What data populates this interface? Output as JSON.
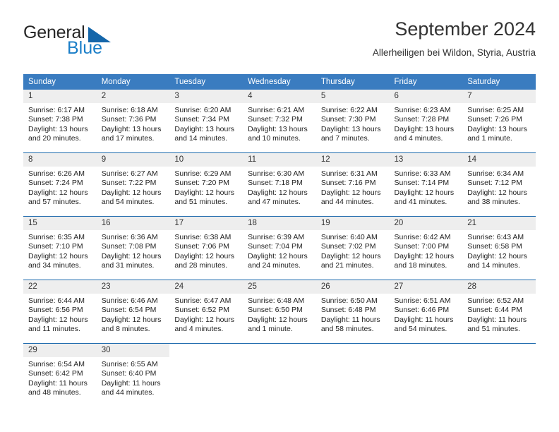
{
  "brand": {
    "name_part1": "General",
    "name_part2": "Blue",
    "accent_color": "#1a7ec8",
    "triangle_color": "#1466aa"
  },
  "header": {
    "title": "September 2024",
    "subtitle": "Allerheiligen bei Wildon, Styria, Austria"
  },
  "theme": {
    "header_bg": "#3a7cc0",
    "row_border": "#1d6aad",
    "daynum_bg": "#eeeeee"
  },
  "weekday_headers": [
    "Sunday",
    "Monday",
    "Tuesday",
    "Wednesday",
    "Thursday",
    "Friday",
    "Saturday"
  ],
  "weeks": [
    [
      {
        "day": "1",
        "sunrise": "Sunrise: 6:17 AM",
        "sunset": "Sunset: 7:38 PM",
        "daylight1": "Daylight: 13 hours",
        "daylight2": "and 20 minutes."
      },
      {
        "day": "2",
        "sunrise": "Sunrise: 6:18 AM",
        "sunset": "Sunset: 7:36 PM",
        "daylight1": "Daylight: 13 hours",
        "daylight2": "and 17 minutes."
      },
      {
        "day": "3",
        "sunrise": "Sunrise: 6:20 AM",
        "sunset": "Sunset: 7:34 PM",
        "daylight1": "Daylight: 13 hours",
        "daylight2": "and 14 minutes."
      },
      {
        "day": "4",
        "sunrise": "Sunrise: 6:21 AM",
        "sunset": "Sunset: 7:32 PM",
        "daylight1": "Daylight: 13 hours",
        "daylight2": "and 10 minutes."
      },
      {
        "day": "5",
        "sunrise": "Sunrise: 6:22 AM",
        "sunset": "Sunset: 7:30 PM",
        "daylight1": "Daylight: 13 hours",
        "daylight2": "and 7 minutes."
      },
      {
        "day": "6",
        "sunrise": "Sunrise: 6:23 AM",
        "sunset": "Sunset: 7:28 PM",
        "daylight1": "Daylight: 13 hours",
        "daylight2": "and 4 minutes."
      },
      {
        "day": "7",
        "sunrise": "Sunrise: 6:25 AM",
        "sunset": "Sunset: 7:26 PM",
        "daylight1": "Daylight: 13 hours",
        "daylight2": "and 1 minute."
      }
    ],
    [
      {
        "day": "8",
        "sunrise": "Sunrise: 6:26 AM",
        "sunset": "Sunset: 7:24 PM",
        "daylight1": "Daylight: 12 hours",
        "daylight2": "and 57 minutes."
      },
      {
        "day": "9",
        "sunrise": "Sunrise: 6:27 AM",
        "sunset": "Sunset: 7:22 PM",
        "daylight1": "Daylight: 12 hours",
        "daylight2": "and 54 minutes."
      },
      {
        "day": "10",
        "sunrise": "Sunrise: 6:29 AM",
        "sunset": "Sunset: 7:20 PM",
        "daylight1": "Daylight: 12 hours",
        "daylight2": "and 51 minutes."
      },
      {
        "day": "11",
        "sunrise": "Sunrise: 6:30 AM",
        "sunset": "Sunset: 7:18 PM",
        "daylight1": "Daylight: 12 hours",
        "daylight2": "and 47 minutes."
      },
      {
        "day": "12",
        "sunrise": "Sunrise: 6:31 AM",
        "sunset": "Sunset: 7:16 PM",
        "daylight1": "Daylight: 12 hours",
        "daylight2": "and 44 minutes."
      },
      {
        "day": "13",
        "sunrise": "Sunrise: 6:33 AM",
        "sunset": "Sunset: 7:14 PM",
        "daylight1": "Daylight: 12 hours",
        "daylight2": "and 41 minutes."
      },
      {
        "day": "14",
        "sunrise": "Sunrise: 6:34 AM",
        "sunset": "Sunset: 7:12 PM",
        "daylight1": "Daylight: 12 hours",
        "daylight2": "and 38 minutes."
      }
    ],
    [
      {
        "day": "15",
        "sunrise": "Sunrise: 6:35 AM",
        "sunset": "Sunset: 7:10 PM",
        "daylight1": "Daylight: 12 hours",
        "daylight2": "and 34 minutes."
      },
      {
        "day": "16",
        "sunrise": "Sunrise: 6:36 AM",
        "sunset": "Sunset: 7:08 PM",
        "daylight1": "Daylight: 12 hours",
        "daylight2": "and 31 minutes."
      },
      {
        "day": "17",
        "sunrise": "Sunrise: 6:38 AM",
        "sunset": "Sunset: 7:06 PM",
        "daylight1": "Daylight: 12 hours",
        "daylight2": "and 28 minutes."
      },
      {
        "day": "18",
        "sunrise": "Sunrise: 6:39 AM",
        "sunset": "Sunset: 7:04 PM",
        "daylight1": "Daylight: 12 hours",
        "daylight2": "and 24 minutes."
      },
      {
        "day": "19",
        "sunrise": "Sunrise: 6:40 AM",
        "sunset": "Sunset: 7:02 PM",
        "daylight1": "Daylight: 12 hours",
        "daylight2": "and 21 minutes."
      },
      {
        "day": "20",
        "sunrise": "Sunrise: 6:42 AM",
        "sunset": "Sunset: 7:00 PM",
        "daylight1": "Daylight: 12 hours",
        "daylight2": "and 18 minutes."
      },
      {
        "day": "21",
        "sunrise": "Sunrise: 6:43 AM",
        "sunset": "Sunset: 6:58 PM",
        "daylight1": "Daylight: 12 hours",
        "daylight2": "and 14 minutes."
      }
    ],
    [
      {
        "day": "22",
        "sunrise": "Sunrise: 6:44 AM",
        "sunset": "Sunset: 6:56 PM",
        "daylight1": "Daylight: 12 hours",
        "daylight2": "and 11 minutes."
      },
      {
        "day": "23",
        "sunrise": "Sunrise: 6:46 AM",
        "sunset": "Sunset: 6:54 PM",
        "daylight1": "Daylight: 12 hours",
        "daylight2": "and 8 minutes."
      },
      {
        "day": "24",
        "sunrise": "Sunrise: 6:47 AM",
        "sunset": "Sunset: 6:52 PM",
        "daylight1": "Daylight: 12 hours",
        "daylight2": "and 4 minutes."
      },
      {
        "day": "25",
        "sunrise": "Sunrise: 6:48 AM",
        "sunset": "Sunset: 6:50 PM",
        "daylight1": "Daylight: 12 hours",
        "daylight2": "and 1 minute."
      },
      {
        "day": "26",
        "sunrise": "Sunrise: 6:50 AM",
        "sunset": "Sunset: 6:48 PM",
        "daylight1": "Daylight: 11 hours",
        "daylight2": "and 58 minutes."
      },
      {
        "day": "27",
        "sunrise": "Sunrise: 6:51 AM",
        "sunset": "Sunset: 6:46 PM",
        "daylight1": "Daylight: 11 hours",
        "daylight2": "and 54 minutes."
      },
      {
        "day": "28",
        "sunrise": "Sunrise: 6:52 AM",
        "sunset": "Sunset: 6:44 PM",
        "daylight1": "Daylight: 11 hours",
        "daylight2": "and 51 minutes."
      }
    ],
    [
      {
        "day": "29",
        "sunrise": "Sunrise: 6:54 AM",
        "sunset": "Sunset: 6:42 PM",
        "daylight1": "Daylight: 11 hours",
        "daylight2": "and 48 minutes."
      },
      {
        "day": "30",
        "sunrise": "Sunrise: 6:55 AM",
        "sunset": "Sunset: 6:40 PM",
        "daylight1": "Daylight: 11 hours",
        "daylight2": "and 44 minutes."
      },
      {
        "day": "",
        "sunrise": "",
        "sunset": "",
        "daylight1": "",
        "daylight2": ""
      },
      {
        "day": "",
        "sunrise": "",
        "sunset": "",
        "daylight1": "",
        "daylight2": ""
      },
      {
        "day": "",
        "sunrise": "",
        "sunset": "",
        "daylight1": "",
        "daylight2": ""
      },
      {
        "day": "",
        "sunrise": "",
        "sunset": "",
        "daylight1": "",
        "daylight2": ""
      },
      {
        "day": "",
        "sunrise": "",
        "sunset": "",
        "daylight1": "",
        "daylight2": ""
      }
    ]
  ]
}
